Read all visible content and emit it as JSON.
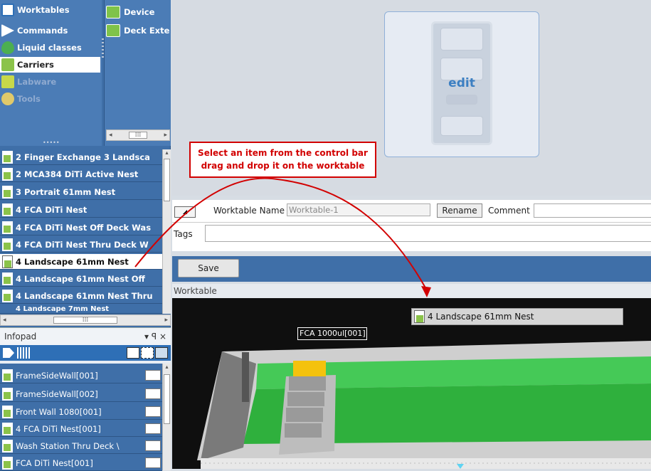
{
  "categories": [
    {
      "label": "Worktables",
      "state": "normal"
    },
    {
      "label": "Commands",
      "state": "normal"
    },
    {
      "label": "Liquid classes",
      "state": "normal"
    },
    {
      "label": "Carriers",
      "state": "selected"
    },
    {
      "label": "Labware",
      "state": "disabled"
    },
    {
      "label": "Tools",
      "state": "disabled"
    }
  ],
  "sub_items": [
    {
      "label": "Device"
    },
    {
      "label": "Deck Exte"
    }
  ],
  "carriers": [
    {
      "label": "2 Finger Exchange 3 Landsca"
    },
    {
      "label": "2 MCA384 DiTi Active Nest"
    },
    {
      "label": "3 Portrait 61mm Nest"
    },
    {
      "label": "4 FCA DiTi Nest"
    },
    {
      "label": "4 FCA DiTi Nest Off Deck Was"
    },
    {
      "label": "4 FCA DiTi Nest Thru Deck W"
    },
    {
      "label": "4 Landscape 61mm Nest"
    },
    {
      "label": "4 Landscape 61mm Nest Off"
    },
    {
      "label": "4 Landscape 61mm Nest Thru"
    },
    {
      "label": "4 Landscape 7mm Nest"
    }
  ],
  "infopad": {
    "title": "Infopad",
    "items": [
      {
        "label": "FrameSideWall[001]"
      },
      {
        "label": "FrameSideWall[002]"
      },
      {
        "label": "Front Wall 1080[001]"
      },
      {
        "label": "4 FCA DiTi Nest[001]"
      },
      {
        "label": "Wash Station Thru Deck \\"
      },
      {
        "label": "FCA DiTi Nest[001]"
      }
    ]
  },
  "edit_label": "edit",
  "callout": {
    "line1": "Select an item from the control bar",
    "line2": "drag and drop it on the worktable"
  },
  "form": {
    "worktable_name_label": "Worktable Name",
    "worktable_name_value": "Worktable-1",
    "rename_label": "Rename",
    "comment_label": "Comment",
    "tags_label": "Tags",
    "save_label": "Save"
  },
  "worktable": {
    "title": "Worktable",
    "dragged_item": "4 Landscape 61mm Nest",
    "tool_label": "FCA 1000ul[001]"
  },
  "colors": {
    "panel_blue": "#3f6fa8",
    "callout_red": "#d20000",
    "deck_green": "#3fc24a",
    "tool_yellow": "#f4c20d"
  }
}
